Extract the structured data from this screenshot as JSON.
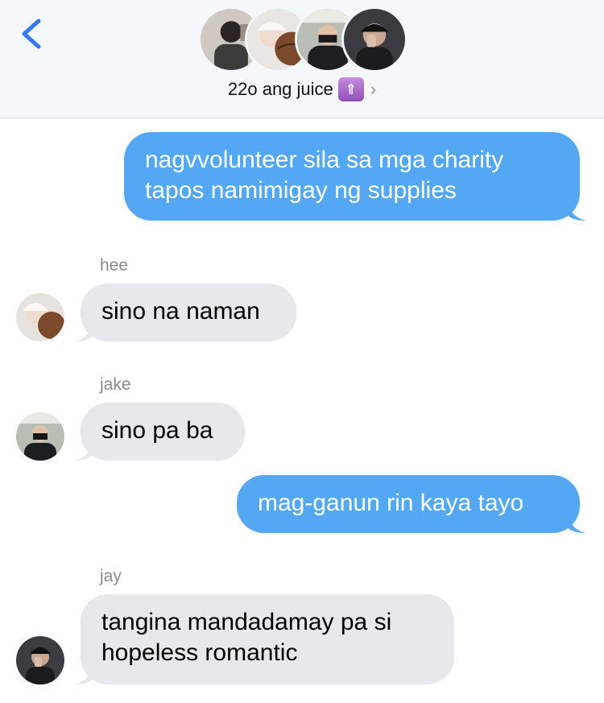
{
  "header": {
    "title": "22o ang juice",
    "emoji": "🛗",
    "chevron": "›",
    "back_icon": "chevron-left-icon",
    "back_color": "#3478f6"
  },
  "group_members": [
    {
      "name": "member-1",
      "tone": "#3b3b3b"
    },
    {
      "name": "member-2",
      "tone": "#7b4a2c"
    },
    {
      "name": "member-3",
      "tone": "#6f7a6b"
    },
    {
      "name": "member-4",
      "tone": "#2f2f33"
    }
  ],
  "colors": {
    "outgoing_bubble": "#54a7f2",
    "incoming_bubble": "#e8e8ec",
    "sender_label": "#8a8a8e"
  },
  "messages": [
    {
      "direction": "outgoing",
      "lines": [
        "nagvvolunteer sila sa mga charity",
        "tapos namimigay ng supplies"
      ]
    },
    {
      "direction": "incoming",
      "sender": "hee",
      "lines": [
        "sino na naman"
      ]
    },
    {
      "direction": "incoming",
      "sender": "jake",
      "lines": [
        "sino pa ba"
      ]
    },
    {
      "direction": "outgoing",
      "lines": [
        "mag-ganun rin kaya tayo"
      ]
    },
    {
      "direction": "incoming",
      "sender": "jay",
      "lines": [
        "tangina mandadamay pa si",
        "hopeless romantic"
      ]
    }
  ]
}
